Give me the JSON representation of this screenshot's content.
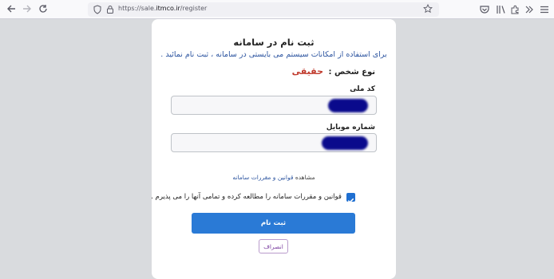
{
  "browser": {
    "url_prefix": "https://sale.",
    "url_domain": "itmco.ir",
    "url_path": "/register"
  },
  "form": {
    "title": "ثبت نام در سامانه",
    "subtitle": "برای استفاده از امکانات سیستم می بایستی در سامانه ، ثبت نام نمائید .",
    "person_type_label": "نوع شخص :",
    "person_type_value": "حقیقی",
    "national_code_label": "کد ملی",
    "mobile_label": "شماره موبایل",
    "terms_prefix": "مشاهده",
    "terms_link": "قوانین و مقررات سامانه",
    "agree_text": "قوانین و مقررات سامانه را مطالعه کرده و تمامی آنها را می پذیرم .",
    "submit_label": "ثبت نام",
    "cancel_label": "انصراف",
    "agree_checked": true
  },
  "colors": {
    "accent": "#2a7ad6",
    "person_type": "#c0392b",
    "subtitle": "#2d55a0"
  }
}
